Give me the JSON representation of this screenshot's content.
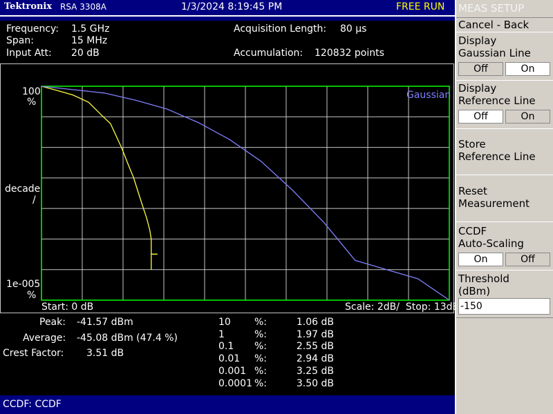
{
  "title_bar": {
    "brand": "Tektronix",
    "model": "RSA 3308A",
    "datetime": "1/3/2024 8:19:45 PM",
    "run_state": "FREE RUN"
  },
  "info": {
    "frequency_label": "Frequency:",
    "frequency_value": "1.5 GHz",
    "span_label": "Span:",
    "span_value": "15 MHz",
    "input_att_label": "Input Att:",
    "input_att_value": "20 dB",
    "acq_length_label": "Acquisition Length:",
    "acq_length_value": "80 µs",
    "accumulation_label": "Accumulation:",
    "accumulation_value": "120832 points"
  },
  "plot": {
    "y_top_label": "100",
    "y_top_unit": "%",
    "y_mid_label": "decade",
    "y_mid_unit": "/",
    "y_bottom_label": "1e-005",
    "y_bottom_unit": "%",
    "start_label": "Start: 0 dB",
    "scale_stop_label": "Scale: 2dB/  Stop: 13dB",
    "gaussian_legend": "Gaussian"
  },
  "chart_data": {
    "type": "line",
    "title": "",
    "xlabel": "",
    "ylabel": "",
    "x_unit": "dB",
    "xlim": [
      0,
      13
    ],
    "y_scale": "log",
    "ylim_percent": [
      1e-05,
      100
    ],
    "grid": true,
    "series": [
      {
        "name": "",
        "color": "#ffff40",
        "x": [
          0,
          0.5,
          1.0,
          1.5,
          1.97,
          2.2,
          2.55,
          2.75,
          2.94,
          3.1,
          3.25,
          3.35,
          3.45,
          3.5,
          3.5,
          3.5,
          3.5,
          3.7
        ],
        "y": [
          100,
          73,
          52,
          30,
          10,
          6,
          1,
          0.3,
          0.1,
          0.03,
          0.01,
          0.005,
          0.002,
          0.001,
          0.0003,
          0.0001,
          0.00032,
          0.00032
        ]
      },
      {
        "name": "Gaussian",
        "color": "#8080ff",
        "x": [
          0,
          1,
          2,
          3,
          4,
          5,
          6,
          7,
          8,
          9,
          10,
          11,
          12,
          13
        ],
        "y": [
          100,
          77.5,
          60,
          35,
          18,
          6.5,
          1.8,
          0.35,
          0.04,
          0.0035,
          0.0002,
          0.0001,
          5e-05,
          1e-05
        ]
      }
    ]
  },
  "results": {
    "peak_label": "Peak:",
    "peak_value": "-41.57 dBm",
    "average_label": "Average:",
    "average_value": "-45.08 dBm (47.4 %)",
    "crest_label": "Crest Factor:",
    "crest_value": "3.51 dB",
    "ccdf_rows": [
      {
        "pct": "10",
        "unit": "%:",
        "db": "1.06 dB"
      },
      {
        "pct": "1",
        "unit": "%:",
        "db": "1.97 dB"
      },
      {
        "pct": "0.1",
        "unit": "%:",
        "db": "2.55 dB"
      },
      {
        "pct": "0.01",
        "unit": "%:",
        "db": "2.94 dB"
      },
      {
        "pct": "0.001",
        "unit": "%:",
        "db": "3.25 dB"
      },
      {
        "pct": "0.0001",
        "unit": "%:",
        "db": "3.50 dB"
      }
    ]
  },
  "status_bar": {
    "text": "CCDF: CCDF"
  },
  "menu": {
    "title": "MEAS SETUP",
    "cancel_back": "Cancel - Back",
    "display_gaussian_1": "Display",
    "display_gaussian_2": "Gaussian Line",
    "gaussian_off": "Off",
    "gaussian_on": "On",
    "gaussian_selected": "On",
    "display_reference_1": "Display",
    "display_reference_2": "Reference Line",
    "reference_off": "Off",
    "reference_on": "On",
    "reference_selected": "Off",
    "store_reference_1": "Store",
    "store_reference_2": "Reference Line",
    "reset_1": "Reset",
    "reset_2": "Measurement",
    "autoscale_1": "CCDF",
    "autoscale_2": "Auto-Scaling",
    "autoscale_on": "On",
    "autoscale_off": "Off",
    "autoscale_selected": "On",
    "threshold_1": "Threshold",
    "threshold_2": "(dBm)",
    "threshold_value": "-150"
  },
  "colors": {
    "title_bar": "#000080",
    "run_state": "#ffff00",
    "grid_border": "#00ff00",
    "grid_lines": "#c8c8c8",
    "trace_measured": "#ffff40",
    "trace_gaussian": "#8080ff",
    "menu_bg": "#d4d0c8"
  }
}
